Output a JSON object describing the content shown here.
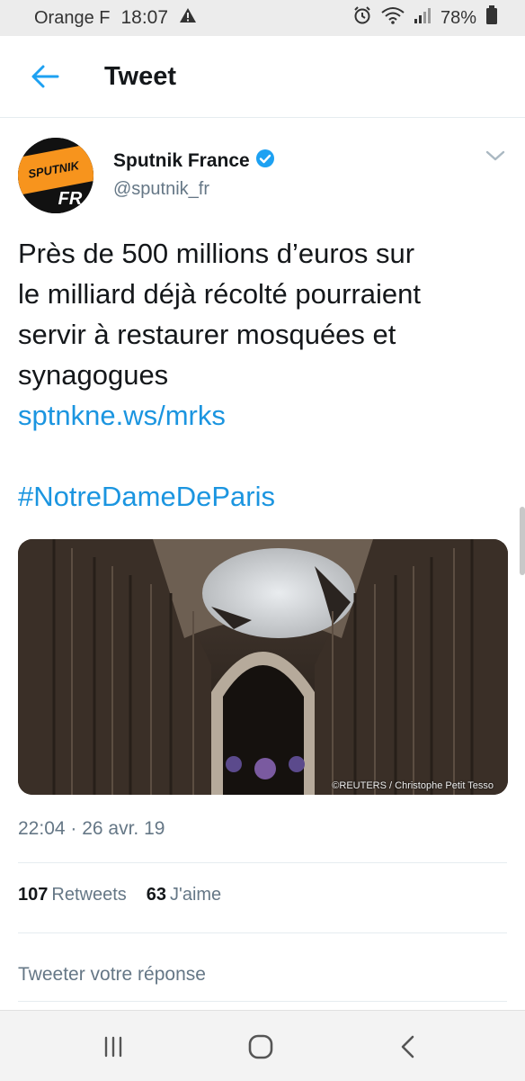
{
  "status_bar": {
    "carrier": "Orange F",
    "time": "18:07",
    "battery": "78%",
    "icons": [
      "warning-icon",
      "alarm-icon",
      "wifi-icon",
      "signal-icon",
      "battery-icon"
    ]
  },
  "header": {
    "title": "Tweet"
  },
  "tweet": {
    "author_name": "Sputnik France",
    "handle": "@sputnik_fr",
    "avatar_text_top": "SPUTNIK",
    "avatar_text_bottom": "FR",
    "text_lines": [
      "Près de 500 millions d’euros sur",
      "le milliard déjà récolté pourraient",
      "servir à restaurer mosquées et",
      "synagogues"
    ],
    "link": "sptnkne.ws/mrks",
    "hashtag": "#NotreDameDeParis",
    "image_credit": "©REUTERS / Christophe Petit Tesso",
    "timestamp": "22:04 · 26 avr. 19",
    "retweets_count": "107",
    "retweets_label": "Retweets",
    "likes_count": "63",
    "likes_label": "J'aime"
  },
  "reply": {
    "placeholder": "Tweeter votre réponse"
  },
  "colors": {
    "link": "#1b95e0",
    "secondary_text": "#657786",
    "verified": "#1da1f2",
    "avatar_orange": "#f7941d"
  }
}
